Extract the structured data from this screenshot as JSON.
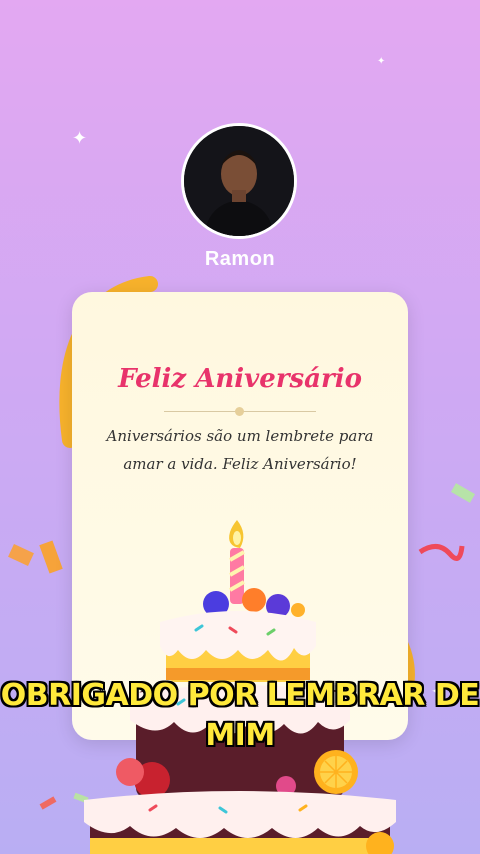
{
  "profile": {
    "name": "Ramon"
  },
  "card": {
    "title": "Feliz Aniversário",
    "message": "Aniversários são um lembrete para amar a vida. Feliz Aniversário!"
  },
  "caption": "OBRIGADO POR LEMBRAR DE MIM",
  "icons": [
    "sparkle-icon",
    "confetti-icon",
    "birthday-cake-icon",
    "ribbon-icon"
  ],
  "colors": {
    "title": "#e8336b",
    "caption": "#ffe93b",
    "caption_outline": "#000000"
  }
}
